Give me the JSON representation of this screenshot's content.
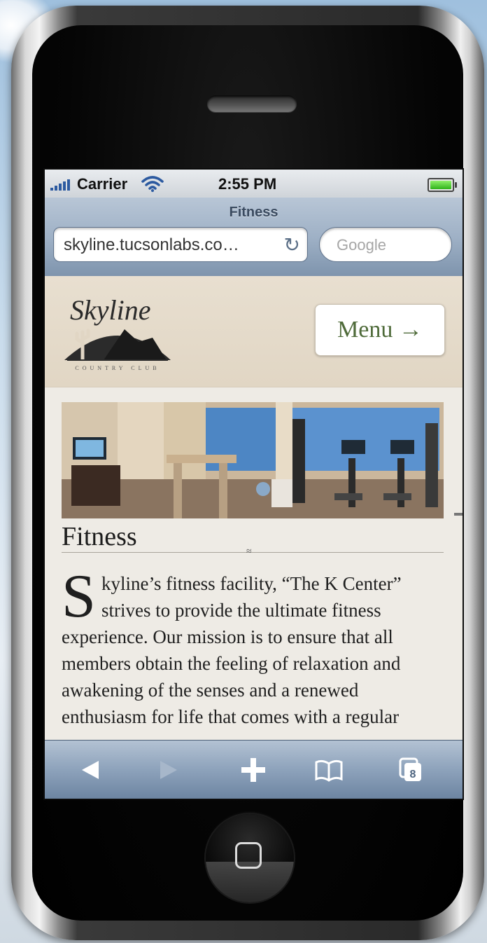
{
  "status_bar": {
    "carrier": "Carrier",
    "time": "2:55 PM"
  },
  "browser": {
    "page_title": "Fitness",
    "url": "skyline.tucsonlabs.co…",
    "search_placeholder": "Google",
    "reload_icon": "reload-icon"
  },
  "site": {
    "logo_alt": "Skyline Country Club",
    "logo_script": "Skyline",
    "logo_subtext": "COUNTRY CLUB",
    "menu_label": "Menu →",
    "heading": "Fitness",
    "ornament": "≈",
    "dropcap": "S",
    "body": "kyline’s fitness facility, “The K Center” strives to provide the ultimate fitness experience. Our mission is to ensure that all members obtain the feeling of relaxation and awakening of the senses and a renewed enthusiasm for life that comes with a regular"
  },
  "toolbar": {
    "back_icon": "back-arrow-icon",
    "forward_icon": "forward-arrow-icon",
    "add_icon": "plus-icon",
    "bookmarks_icon": "bookmarks-book-icon",
    "pages_icon": "pages-icon",
    "pages_count": "8"
  },
  "colors": {
    "menu_text": "#4f6b3a",
    "chrome_blue": "#8da2bb",
    "header_beige": "#e1d6c4"
  }
}
